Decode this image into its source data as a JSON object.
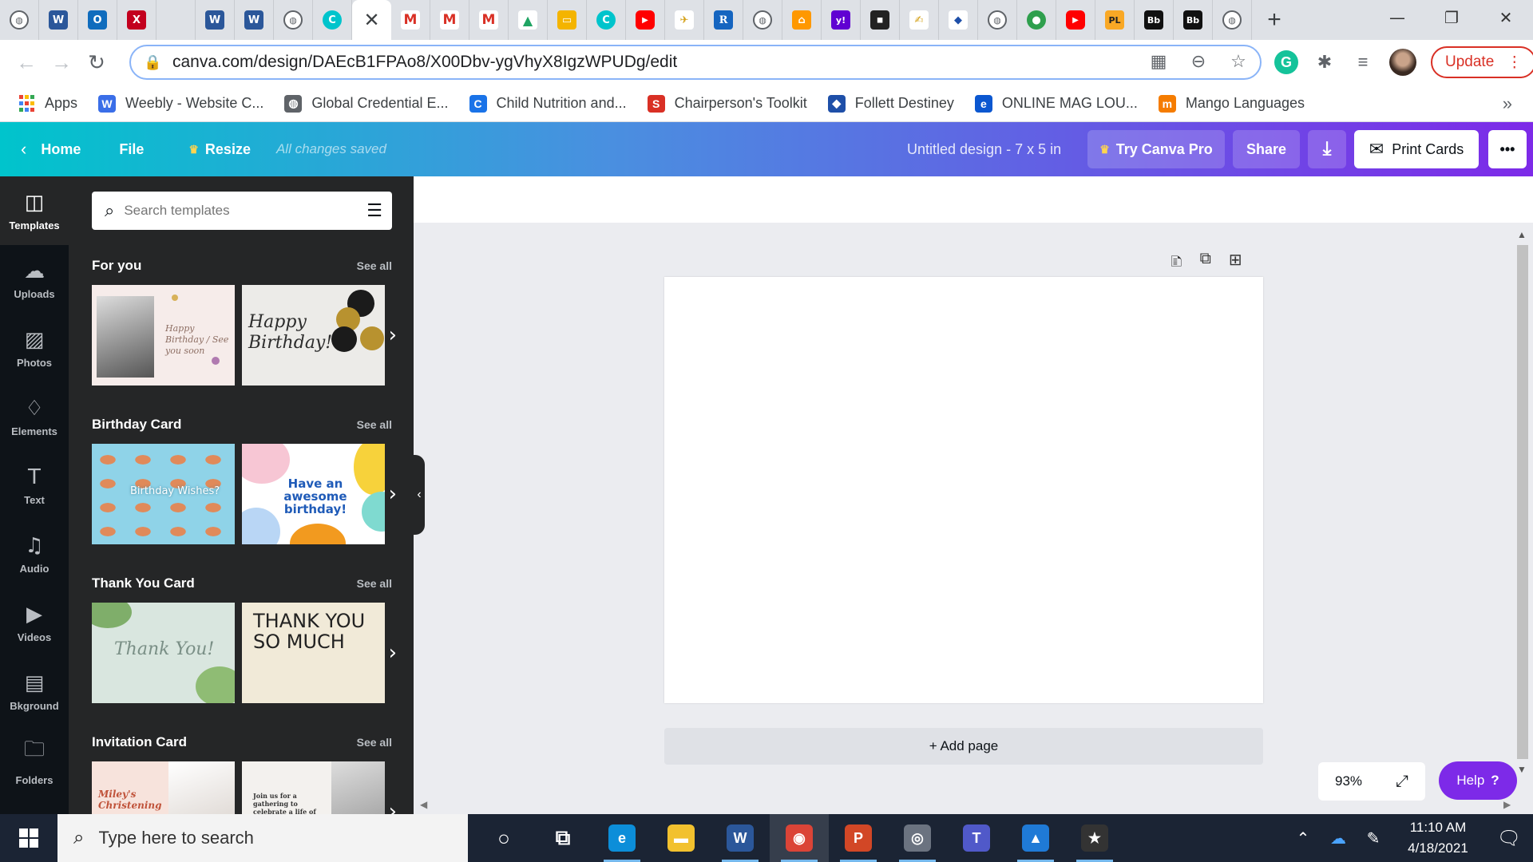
{
  "browser": {
    "url": "canva.com/design/DAEcB1FPAo8/X00Dbv-ygVhyX8IgzWPUDg/edit",
    "update_label": "Update",
    "tabs": [
      {
        "icon": "globe-icon",
        "glyph": "◍",
        "cls": "fi-globe"
      },
      {
        "icon": "word-icon",
        "glyph": "W",
        "cls": "fi-word"
      },
      {
        "icon": "outlook-icon",
        "glyph": "O",
        "cls": "fi-outlook"
      },
      {
        "icon": "pdf-x-icon",
        "glyph": "X",
        "cls": "fi-pdfx"
      },
      {
        "icon": "blank-tab-icon",
        "glyph": "",
        "cls": ""
      },
      {
        "icon": "word-icon",
        "glyph": "W",
        "cls": "fi-word"
      },
      {
        "icon": "word-icon",
        "glyph": "W",
        "cls": "fi-word"
      },
      {
        "icon": "globe-icon",
        "glyph": "◍",
        "cls": "fi-globe"
      },
      {
        "icon": "canva-icon",
        "glyph": "C",
        "cls": "fi-canva"
      },
      {
        "icon": "close-icon",
        "glyph": "✕",
        "cls": "active"
      },
      {
        "icon": "gmail-icon",
        "glyph": "M",
        "cls": "fi-gmail"
      },
      {
        "icon": "gmail-icon",
        "glyph": "M",
        "cls": "fi-gmail"
      },
      {
        "icon": "gmail-icon",
        "glyph": "M",
        "cls": "fi-gmail"
      },
      {
        "icon": "google-drive-icon",
        "glyph": "▲",
        "cls": "fi-drive"
      },
      {
        "icon": "google-slides-icon",
        "glyph": "▭",
        "cls": "fi-slides"
      },
      {
        "icon": "canva-icon",
        "glyph": "C",
        "cls": "fi-canva"
      },
      {
        "icon": "youtube-icon",
        "glyph": "▶",
        "cls": "fi-yt"
      },
      {
        "icon": "flag-icon",
        "glyph": "✈",
        "cls": "fi-pen"
      },
      {
        "icon": "r-icon",
        "glyph": "R",
        "cls": "fi-r"
      },
      {
        "icon": "globe-icon",
        "glyph": "◍",
        "cls": "fi-globe"
      },
      {
        "icon": "home-icon",
        "glyph": "⌂",
        "cls": "fi-home"
      },
      {
        "icon": "yahoo-icon",
        "glyph": "y!",
        "cls": "fi-yahoo"
      },
      {
        "icon": "dark-app-icon",
        "glyph": "◼",
        "cls": "fi-dark"
      },
      {
        "icon": "signature-icon",
        "glyph": "✍",
        "cls": "fi-pen"
      },
      {
        "icon": "follett-icon",
        "glyph": "◆",
        "cls": "fi-follett"
      },
      {
        "icon": "globe-icon",
        "glyph": "◍",
        "cls": "fi-globe"
      },
      {
        "icon": "green-shield-icon",
        "glyph": "●",
        "cls": "fi-green"
      },
      {
        "icon": "youtube-icon",
        "glyph": "▶",
        "cls": "fi-yt"
      },
      {
        "icon": "pl-icon",
        "glyph": "PL",
        "cls": "fi-pl"
      },
      {
        "icon": "blackboard-icon",
        "glyph": "Bb",
        "cls": "fi-bb"
      },
      {
        "icon": "blackboard-icon",
        "glyph": "Bb",
        "cls": "fi-bb"
      },
      {
        "icon": "globe-icon",
        "glyph": "◍",
        "cls": "fi-globe"
      }
    ]
  },
  "bookmarks": [
    {
      "label": "Apps",
      "icon": "apps-grid-icon"
    },
    {
      "label": "Weebly - Website C...",
      "icon": "weebly-icon",
      "glyph": "W",
      "color": "#3a6ee8"
    },
    {
      "label": "Global Credential E...",
      "icon": "globe-icon",
      "glyph": "◍",
      "color": "#5f6368"
    },
    {
      "label": "Child Nutrition and...",
      "icon": "child-nutrition-icon",
      "glyph": "C",
      "color": "#1a73e8"
    },
    {
      "label": "Chairperson's Toolkit",
      "icon": "s-logo-icon",
      "glyph": "S",
      "color": "#d93025"
    },
    {
      "label": "Follett Destiney",
      "icon": "follett-icon",
      "glyph": "◆",
      "color": "#1e4fa8"
    },
    {
      "label": "ONLINE MAG LOU...",
      "icon": "online-mag-icon",
      "glyph": "e",
      "color": "#0b57d0"
    },
    {
      "label": "Mango Languages",
      "icon": "mango-icon",
      "glyph": "m",
      "color": "#f57c00"
    }
  ],
  "canva": {
    "home": "Home",
    "file": "File",
    "resize": "Resize",
    "saved": "All changes saved",
    "title": "Untitled design - 7 x 5 in",
    "try_pro": "Try Canva Pro",
    "share": "Share",
    "print": "Print Cards",
    "more": "•••",
    "rail": [
      {
        "label": "Templates",
        "icon": "templates-icon",
        "glyph": "◫"
      },
      {
        "label": "Uploads",
        "icon": "uploads-icon",
        "glyph": "☁"
      },
      {
        "label": "Photos",
        "icon": "photos-icon",
        "glyph": "▨"
      },
      {
        "label": "Elements",
        "icon": "elements-icon",
        "glyph": "♢"
      },
      {
        "label": "Text",
        "icon": "text-icon",
        "glyph": "T"
      },
      {
        "label": "Audio",
        "icon": "audio-icon",
        "glyph": "♫"
      },
      {
        "label": "Videos",
        "icon": "videos-icon",
        "glyph": "▶"
      },
      {
        "label": "Bkground",
        "icon": "background-icon",
        "glyph": "▤"
      },
      {
        "label": "Folders",
        "icon": "folders-icon",
        "glyph": "🗀"
      }
    ],
    "search_placeholder": "Search templates",
    "see_all": "See all",
    "sections": [
      {
        "title": "For you",
        "t1": "Happy Birthday / See you soon",
        "t2": "Happy Birthday!"
      },
      {
        "title": "Birthday Card",
        "t1": "Birthday Wishes?",
        "t2": "Have an awesome birthday!"
      },
      {
        "title": "Thank You Card",
        "t1": "Thank You!",
        "t2": "THANK YOU SO MUCH"
      },
      {
        "title": "Invitation Card",
        "t1": "Miley's Christening",
        "t2": "Join us for a gathering to celebrate a life of merriment and laughs"
      }
    ],
    "add_page": "+ Add page",
    "zoom": "93%",
    "help": "Help",
    "help_glyph": "?"
  },
  "taskbar": {
    "search_placeholder": "Type here to search",
    "time": "11:10 AM",
    "date": "4/18/2021",
    "apps": [
      {
        "icon": "cortana-icon",
        "glyph": "○",
        "bg": "transparent"
      },
      {
        "icon": "task-view-icon",
        "glyph": "⧉",
        "bg": "transparent"
      },
      {
        "icon": "edge-icon",
        "glyph": "e",
        "bg": "#0c8ed9"
      },
      {
        "icon": "file-explorer-icon",
        "glyph": "▬",
        "bg": "#f2c12e"
      },
      {
        "icon": "word-icon",
        "glyph": "W",
        "bg": "#2b579a"
      },
      {
        "icon": "chrome-icon",
        "glyph": "◉",
        "bg": "#db4437"
      },
      {
        "icon": "powerpoint-icon",
        "glyph": "P",
        "bg": "#d24726"
      },
      {
        "icon": "camera-icon",
        "glyph": "◎",
        "bg": "#6b7380"
      },
      {
        "icon": "teams-icon",
        "glyph": "T",
        "bg": "#5059c9"
      },
      {
        "icon": "photos-icon",
        "glyph": "▲",
        "bg": "#1f7ad6"
      },
      {
        "icon": "movie-maker-icon",
        "glyph": "★",
        "bg": "#333"
      }
    ]
  }
}
